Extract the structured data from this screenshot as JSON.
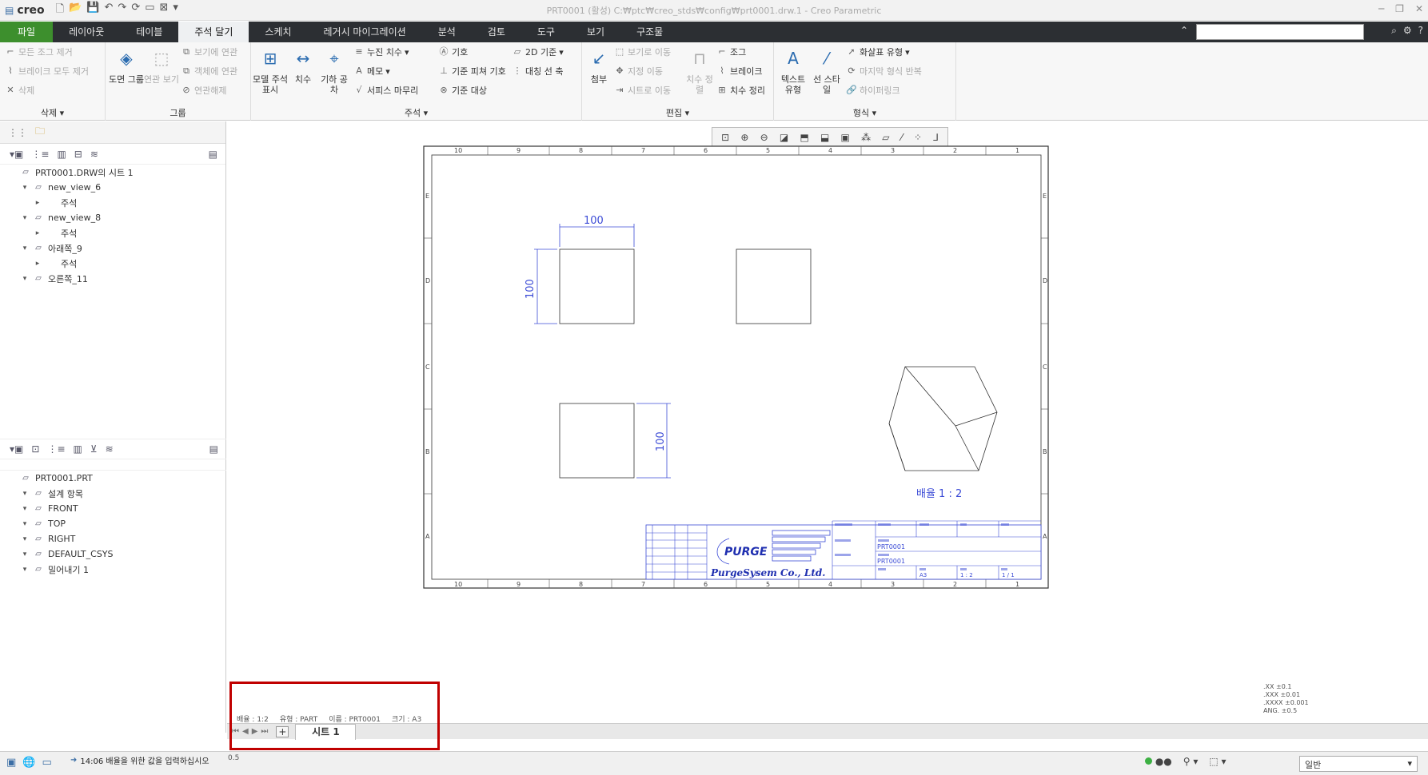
{
  "app": {
    "logo": "creo",
    "title": "PRT0001 (활성) C:₩ptc₩creo_stds₩config₩prt0001.drw.1 - Creo Parametric"
  },
  "tabs": [
    "파일",
    "레이아웃",
    "테이블",
    "주석 달기",
    "스케치",
    "레거시 마이그레이션",
    "분석",
    "검토",
    "도구",
    "보기",
    "구조물"
  ],
  "ribbon": {
    "delete_group": {
      "label": "삭제",
      "items": [
        "모든 조그 제거",
        "브레이크 모두 제거",
        "삭제"
      ]
    },
    "group_group": {
      "label": "그룹",
      "big": [
        "도면 그룹",
        "연관 보기"
      ],
      "items": [
        "보기에 연관",
        "객체에 연관",
        "연관해제"
      ]
    },
    "annotate_group": {
      "label": "주석",
      "big": [
        "모델 주석 표시",
        "치수",
        "기하 공차"
      ],
      "items": [
        "누진 치수",
        "메모",
        "서피스 마무리",
        "기호",
        "기준 피쳐 기호",
        "기준 대상",
        "2D 기준",
        "대칭 선 축"
      ]
    },
    "edit_group": {
      "label": "편집",
      "big": [
        "첨부",
        "치수 정렬"
      ],
      "items": [
        "보기로 이동",
        "지정 이동",
        "시트로 이동",
        "조그",
        "브레이크",
        "치수 정리"
      ]
    },
    "format_group": {
      "label": "형식",
      "big": [
        "텍스트 유형",
        "선 스타일"
      ],
      "items": [
        "화살표 유형",
        "마지막 형식 반복",
        "하이퍼링크"
      ]
    }
  },
  "drawing_tree": [
    {
      "label": "PRT0001.DRW의 시트 1",
      "level": 0
    },
    {
      "label": "new_view_6",
      "level": 1
    },
    {
      "label": "주석",
      "level": 2
    },
    {
      "label": "new_view_8",
      "level": 1
    },
    {
      "label": "주석",
      "level": 2
    },
    {
      "label": "아래쪽_9",
      "level": 1
    },
    {
      "label": "주석",
      "level": 2
    },
    {
      "label": "오른쪽_11",
      "level": 1
    }
  ],
  "model_tree": [
    {
      "label": "PRT0001.PRT",
      "level": 0
    },
    {
      "label": "설계 항목",
      "level": 1
    },
    {
      "label": "FRONT",
      "level": 1
    },
    {
      "label": "TOP",
      "level": 1
    },
    {
      "label": "RIGHT",
      "level": 1
    },
    {
      "label": "DEFAULT_CSYS",
      "level": 1
    },
    {
      "label": "밀어내기 1",
      "level": 1
    }
  ],
  "drawing": {
    "dim_top": "100",
    "dim_left": "100",
    "dim_bottom": "100",
    "scale_label": "배율  1 : 2",
    "column_labels": [
      "10",
      "9",
      "8",
      "7",
      "6",
      "5",
      "4",
      "3",
      "2",
      "1"
    ],
    "row_labels": [
      "E",
      "D",
      "C",
      "B",
      "A"
    ],
    "company": "PurgeSysem Co., Ltd.",
    "logo_text": "PURGE",
    "part_name_1": "PRT0001",
    "part_name_2": "PRT0001",
    "title_size": "A3",
    "title_scale": "1 : 2",
    "title_sheet": "1 / 1"
  },
  "sheet_info": {
    "scale": "배율 : 1:2",
    "type": "유형 : PART",
    "name": "이름 : PRT0001",
    "size": "크기 : A3"
  },
  "tolerance": [
    ".XX   ±0.1",
    ".XXX  ±0.01",
    ".XXXX ±0.001",
    "ANG.  ±0.5"
  ],
  "sheet_tab": "시트 1",
  "status": {
    "message": "14:06 배율을 위한 값을 입력하십시오",
    "value": "0.5",
    "filter": "일반"
  }
}
